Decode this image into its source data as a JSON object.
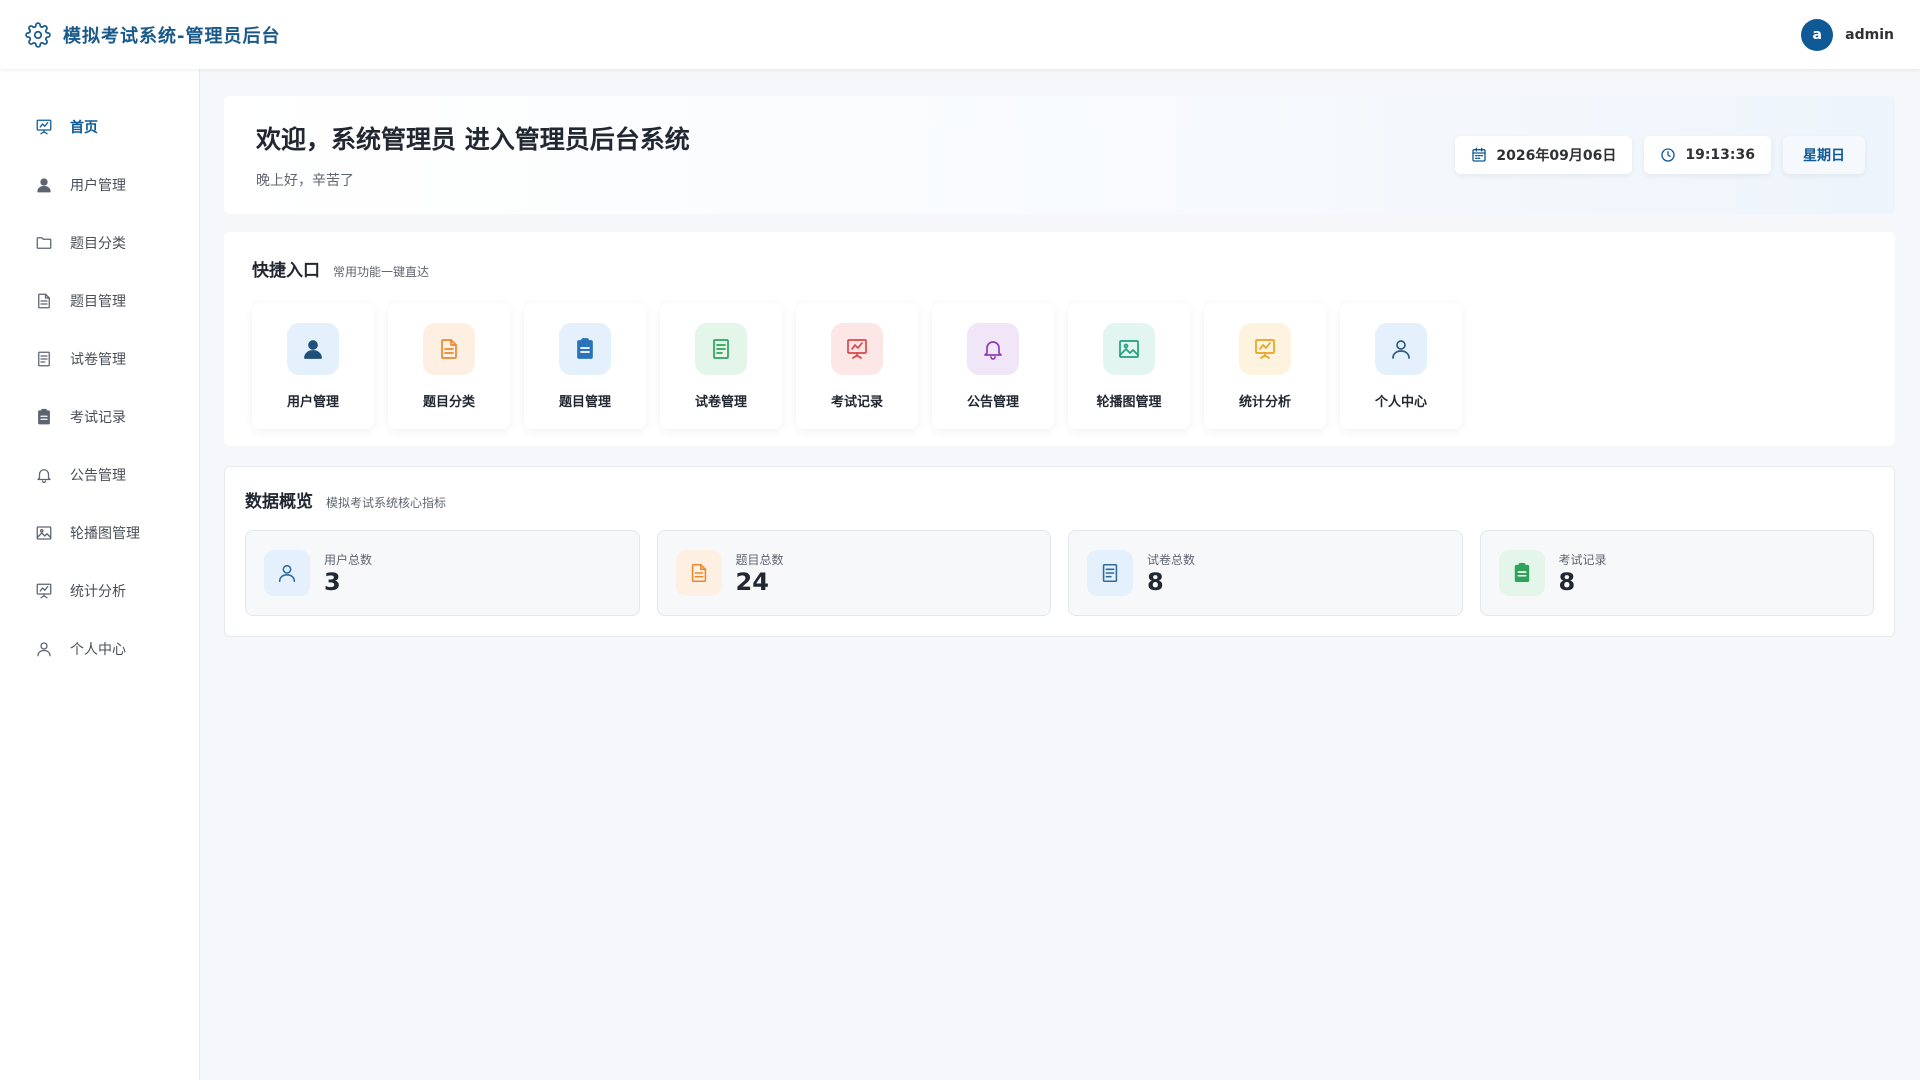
{
  "app": {
    "title": "模拟考试系统-管理员后台",
    "brand_icon": "gear-icon"
  },
  "user": {
    "avatar_letter": "a",
    "name": "admin"
  },
  "sidebar": {
    "active": "首页",
    "items": [
      {
        "label": "首页",
        "icon": "chart-board-icon"
      },
      {
        "label": "用户管理",
        "icon": "user-filled-icon"
      },
      {
        "label": "题目分类",
        "icon": "folder-icon"
      },
      {
        "label": "题目管理",
        "icon": "document-icon"
      },
      {
        "label": "试卷管理",
        "icon": "tickets-icon"
      },
      {
        "label": "考试记录",
        "icon": "clipboard-icon"
      },
      {
        "label": "公告管理",
        "icon": "bell-icon"
      },
      {
        "label": "轮播图管理",
        "icon": "picture-icon"
      },
      {
        "label": "统计分析",
        "icon": "chart-board-icon"
      },
      {
        "label": "个人中心",
        "icon": "user-icon"
      }
    ]
  },
  "welcome": {
    "title": "欢迎，系统管理员 进入管理员后台系统",
    "subtitle": "晚上好，辛苦了",
    "date": "2026年09月06日",
    "time": "19:13:36",
    "weekday": "星期日"
  },
  "quick": {
    "title": "快捷入口",
    "subtitle": "常用功能一键直达",
    "items": [
      {
        "label": "用户管理",
        "icon": "user-filled-icon",
        "bg": "#e4f1fc",
        "fg": "#1f4f7a"
      },
      {
        "label": "题目分类",
        "icon": "document-icon",
        "bg": "#fdf0e2",
        "fg": "#e8892e"
      },
      {
        "label": "题目管理",
        "icon": "clipboard-icon",
        "bg": "#e4f1fc",
        "fg": "#2a73b8"
      },
      {
        "label": "试卷管理",
        "icon": "tickets-icon",
        "bg": "#e4f6ea",
        "fg": "#2fa35a"
      },
      {
        "label": "考试记录",
        "icon": "chart-board-icon",
        "bg": "#fce6e6",
        "fg": "#d9484a"
      },
      {
        "label": "公告管理",
        "icon": "bell-icon",
        "bg": "#f1e6f8",
        "fg": "#8d3fb8"
      },
      {
        "label": "轮播图管理",
        "icon": "picture-icon",
        "bg": "#e2f5f0",
        "fg": "#23a07f"
      },
      {
        "label": "统计分析",
        "icon": "chart-board-icon",
        "bg": "#fdf3de",
        "fg": "#e6a324"
      },
      {
        "label": "个人中心",
        "icon": "user-icon",
        "bg": "#e4f1fc",
        "fg": "#2f5b80"
      }
    ]
  },
  "overview": {
    "title": "数据概览",
    "subtitle": "模拟考试系统核心指标",
    "stats": [
      {
        "label": "用户总数",
        "value": "3",
        "icon": "user-icon",
        "bg": "#e4f1fc",
        "fg": "#2f6a9a"
      },
      {
        "label": "题目总数",
        "value": "24",
        "icon": "document-icon",
        "bg": "#fdf0e2",
        "fg": "#e8892e"
      },
      {
        "label": "试卷总数",
        "value": "8",
        "icon": "tickets-icon",
        "bg": "#e4f1fc",
        "fg": "#2f6a9a"
      },
      {
        "label": "考试记录",
        "value": "8",
        "icon": "clipboard-icon",
        "bg": "#e4f6ea",
        "fg": "#2fa35a"
      }
    ]
  }
}
